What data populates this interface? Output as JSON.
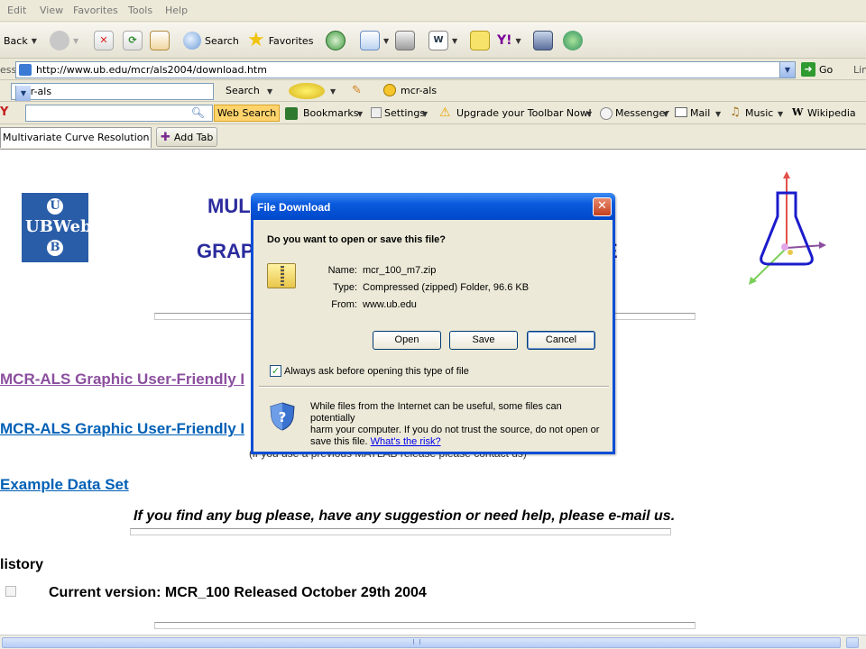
{
  "menu": [
    "Edit",
    "View",
    "Favorites",
    "Tools",
    "Help"
  ],
  "toolbar": {
    "back": "Back",
    "search": "Search",
    "favorites": "Favorites"
  },
  "address": {
    "label": "ess",
    "url": "http://www.ub.edu/mcr/als2004/download.htm",
    "go": "Go",
    "links": "Lin"
  },
  "bar3": {
    "query": "mcr-als",
    "search": "Search",
    "highlight": "mcr-als"
  },
  "bar4": {
    "web_search": "Web Search",
    "bookmarks": "Bookmarks",
    "settings": "Settings",
    "upgrade": "Upgrade your Toolbar Now!",
    "messenger": "Messenger",
    "mail": "Mail",
    "music": "Music",
    "wikipedia": "Wikipedia"
  },
  "tabs": {
    "active": "Multivariate Curve Resolution - ...",
    "add": "Add Tab"
  },
  "page": {
    "logo_text": "UBWeb",
    "logo_u": "U",
    "logo_b": "B",
    "title1": "MUL",
    "title2": "GRAP",
    "title2_end": "E",
    "link1": "MCR-ALS Graphic User-Friendly I",
    "link2": "MCR-ALS Graphic User-Friendly I",
    "behind_text": "(if you use a previous MATLAB release please contact us)",
    "example_link": "Example Data Set",
    "bug_text": "If you find any bug please, have any suggestion or need help, please e-mail us.",
    "history": "listory",
    "current_version": "Current version: MCR_100 Released October 29th 2004"
  },
  "dialog": {
    "title": "File Download",
    "question": "Do you want to open or save this file?",
    "name_label": "Name:",
    "name_value": "mcr_100_m7.zip",
    "type_label": "Type:",
    "type_value": "Compressed (zipped) Folder, 96.6 KB",
    "from_label": "From:",
    "from_value": "www.ub.edu",
    "open": "Open",
    "save": "Save",
    "cancel": "Cancel",
    "always_ask": "Always ask before opening this type of file",
    "always_ask_checked": true,
    "warning_line1": "While files from the Internet can be useful, some files can potentially",
    "warning_line2": "harm your computer. If you do not trust the source, do not open or",
    "warning_line3": "save this file.",
    "risk_link": "What's the risk?"
  },
  "colors": {
    "link_visited": "#8b4f9e",
    "link": "#0060b6",
    "title_blue": "#2b2b9e",
    "xp_blue": "#0a4ed6"
  }
}
